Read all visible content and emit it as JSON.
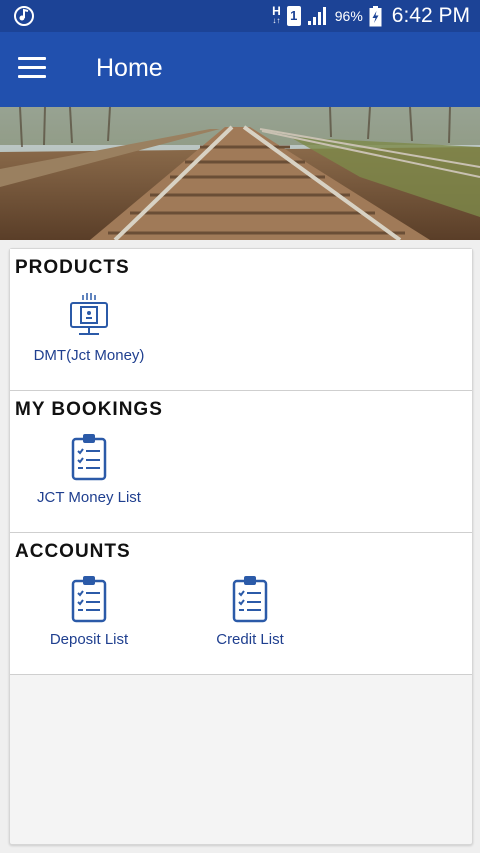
{
  "status_bar": {
    "network_type": "H",
    "sim_slot": "1",
    "battery_percent": "96%",
    "time": "6:42 PM"
  },
  "app_bar": {
    "title": "Home"
  },
  "sections": {
    "products": {
      "title": "PRODUCTS",
      "items": [
        {
          "label": "DMT(Jct Money)",
          "icon": "money-transfer-icon"
        }
      ]
    },
    "bookings": {
      "title": "MY BOOKINGS",
      "items": [
        {
          "label": "JCT Money List",
          "icon": "clipboard-list-icon"
        }
      ]
    },
    "accounts": {
      "title": "ACCOUNTS",
      "items": [
        {
          "label": "Deposit List",
          "icon": "clipboard-list-icon"
        },
        {
          "label": "Credit List",
          "icon": "clipboard-list-icon"
        }
      ]
    }
  },
  "colors": {
    "status_bar": "#1c4396",
    "app_bar": "#2150ae",
    "icon_blue": "#2b5aa8",
    "label_blue": "#1f3f8f"
  }
}
